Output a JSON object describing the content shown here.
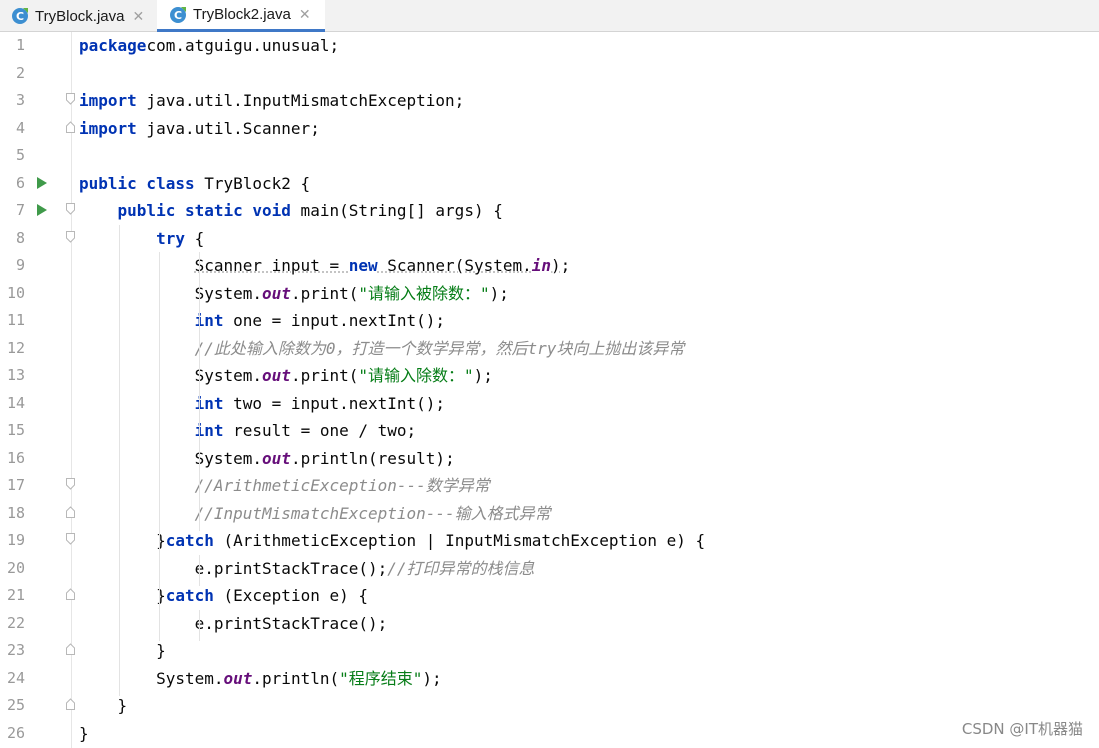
{
  "tabs": [
    {
      "label": "TryBlock.java",
      "icon": "java-class-icon",
      "active": false
    },
    {
      "label": "TryBlock2.java",
      "icon": "java-class-icon",
      "active": true
    }
  ],
  "colors": {
    "keyword": "#0033b3",
    "static_field": "#660e7a",
    "string": "#067d17",
    "comment": "#8c8c8c",
    "run_icon": "#3f9a4a",
    "active_tab_underline": "#3f78c7"
  },
  "lines": [
    [
      [
        "kw",
        "package"
      ],
      [
        "",
        "com.atguigu.unusual;"
      ]
    ],
    [],
    [
      [
        "kw",
        "import"
      ],
      [
        "",
        " java.util.InputMismatchException;"
      ]
    ],
    [
      [
        "kw",
        "import"
      ],
      [
        "",
        " java.util.Scanner;"
      ]
    ],
    [],
    [
      [
        "kw",
        "public class"
      ],
      [
        "",
        " TryBlock2 {"
      ]
    ],
    [
      [
        "",
        "    "
      ],
      [
        "kw",
        "public static void"
      ],
      [
        "",
        " main(String[] args) {"
      ]
    ],
    [
      [
        "",
        "        "
      ],
      [
        "kw",
        "try"
      ],
      [
        "",
        " {"
      ]
    ],
    [
      [
        "",
        "            "
      ],
      [
        "wv",
        "Scanner input = "
      ],
      [
        "kw",
        "new"
      ],
      [
        "wv",
        " Scanner(System."
      ],
      [
        "st",
        "in"
      ],
      [
        "wv",
        ")"
      ],
      [
        ";",
        ""
      ]
    ],
    [
      [
        "",
        "            System."
      ],
      [
        "st",
        "out"
      ],
      [
        "",
        ".print("
      ],
      [
        "str",
        "\"请输入被除数：\""
      ],
      [
        "",
        ");"
      ]
    ],
    [
      [
        "",
        "            "
      ],
      [
        "kw",
        "int"
      ],
      [
        "",
        " one = input.nextInt();"
      ]
    ],
    [
      [
        "",
        "            "
      ],
      [
        "cm",
        "//此处输入除数为0，打造一个数学异常，然后try块向上抛出该异常"
      ]
    ],
    [
      [
        "",
        "            System."
      ],
      [
        "st",
        "out"
      ],
      [
        "",
        ".print("
      ],
      [
        "str",
        "\"请输入除数：\""
      ],
      [
        "",
        ");"
      ]
    ],
    [
      [
        "",
        "            "
      ],
      [
        "kw",
        "int"
      ],
      [
        "",
        " two = input.nextInt();"
      ]
    ],
    [
      [
        "",
        "            "
      ],
      [
        "kw",
        "int"
      ],
      [
        "",
        " result = one / two;"
      ]
    ],
    [
      [
        "",
        "            System."
      ],
      [
        "st",
        "out"
      ],
      [
        "",
        ".println(result);"
      ]
    ],
    [
      [
        "",
        "            "
      ],
      [
        "cm",
        "//ArithmeticException---数学异常"
      ]
    ],
    [
      [
        "",
        "            "
      ],
      [
        "cm",
        "//InputMismatchException---输入格式异常"
      ]
    ],
    [
      [
        "",
        "        }"
      ],
      [
        "kw",
        "catch"
      ],
      [
        "",
        " (ArithmeticException | InputMismatchException e) {"
      ]
    ],
    [
      [
        "",
        "            e.printStackTrace();"
      ],
      [
        "cm",
        "//打印异常的栈信息"
      ]
    ],
    [
      [
        "",
        "        }"
      ],
      [
        "kw",
        "catch"
      ],
      [
        "",
        " (Exception e) {"
      ]
    ],
    [
      [
        "",
        "            e.printStackTrace();"
      ]
    ],
    [
      [
        "",
        "        }"
      ]
    ],
    [
      [
        "",
        "        System."
      ],
      [
        "st",
        "out"
      ],
      [
        "",
        ".println("
      ],
      [
        "str",
        "\"程序结束\""
      ],
      [
        "",
        ");"
      ]
    ],
    [
      [
        "",
        "    }"
      ]
    ],
    [
      [
        "",
        "}"
      ]
    ]
  ],
  "gutter": {
    "run_lines": [
      6,
      7
    ],
    "fold_open_lines": [
      3,
      7,
      8,
      17,
      19
    ],
    "fold_close_lines": [
      4,
      18,
      21,
      23,
      25
    ]
  },
  "watermark": "CSDN @IT机器猫"
}
